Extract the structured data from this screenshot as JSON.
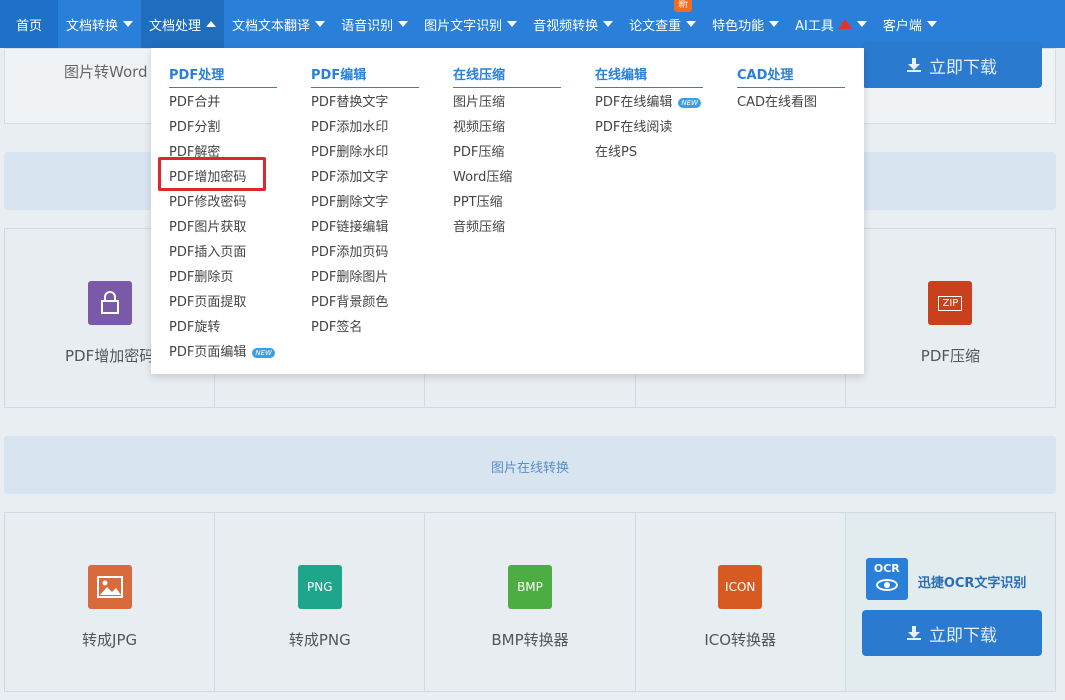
{
  "nav": {
    "items": [
      {
        "label": "首页",
        "caret": false
      },
      {
        "label": "文档转换",
        "caret": true
      },
      {
        "label": "文档处理",
        "caret": true,
        "active": true
      },
      {
        "label": "文档文本翻译",
        "caret": true
      },
      {
        "label": "语音识别",
        "caret": true
      },
      {
        "label": "图片文字识别",
        "caret": true
      },
      {
        "label": "音视频转换",
        "caret": true
      },
      {
        "label": "论文查重",
        "caret": true,
        "badge": "新"
      },
      {
        "label": "特色功能",
        "caret": true
      },
      {
        "label": "AI工具",
        "caret": true
      },
      {
        "label": "客户端",
        "caret": true
      }
    ]
  },
  "background": {
    "top_card_label": "图片转Word",
    "download_label": "立即下载",
    "band_label": "图片在线转换",
    "row1": {
      "first_label": "PDF增加密码",
      "last_label": "PDF压缩",
      "last_icon_text": "ZIP"
    },
    "row2": [
      {
        "label": "转成JPG",
        "icon_text": "",
        "icon": "image-icon",
        "color": "#d86a3c"
      },
      {
        "label": "转成PNG",
        "icon_text": "PNG",
        "icon": "png-icon",
        "color": "#1fa58a"
      },
      {
        "label": "BMP转换器",
        "icon_text": "BMP",
        "icon": "bmp-icon",
        "color": "#4cae42"
      },
      {
        "label": "ICO转换器",
        "icon_text": "ICON",
        "icon": "ico-icon",
        "color": "#d85a23"
      }
    ],
    "ocr": {
      "badge": "OCR",
      "label": "迅捷OCR文字识别",
      "download_label": "立即下载"
    }
  },
  "dropdown": {
    "columns": [
      {
        "title": "PDF处理",
        "items": [
          {
            "label": "PDF合并"
          },
          {
            "label": "PDF分割"
          },
          {
            "label": "PDF解密"
          },
          {
            "label": "PDF增加密码",
            "highlighted": true
          },
          {
            "label": "PDF修改密码"
          },
          {
            "label": "PDF图片获取"
          },
          {
            "label": "PDF插入页面"
          },
          {
            "label": "PDF删除页"
          },
          {
            "label": "PDF页面提取"
          },
          {
            "label": "PDF旋转"
          },
          {
            "label": "PDF页面编辑",
            "new": "NEW"
          }
        ]
      },
      {
        "title": "PDF编辑",
        "items": [
          {
            "label": "PDF替换文字"
          },
          {
            "label": "PDF添加水印"
          },
          {
            "label": "PDF删除水印"
          },
          {
            "label": "PDF添加文字"
          },
          {
            "label": "PDF删除文字"
          },
          {
            "label": "PDF链接编辑"
          },
          {
            "label": "PDF添加页码"
          },
          {
            "label": "PDF删除图片"
          },
          {
            "label": "PDF背景颜色"
          },
          {
            "label": "PDF签名"
          }
        ]
      },
      {
        "title": "在线压缩",
        "items": [
          {
            "label": "图片压缩"
          },
          {
            "label": "视频压缩"
          },
          {
            "label": "PDF压缩"
          },
          {
            "label": "Word压缩"
          },
          {
            "label": "PPT压缩"
          },
          {
            "label": "音频压缩"
          }
        ]
      },
      {
        "title": "在线编辑",
        "items": [
          {
            "label": "PDF在线编辑",
            "new": "NEW"
          },
          {
            "label": "PDF在线阅读"
          },
          {
            "label": "在线PS"
          }
        ]
      },
      {
        "title": "CAD处理",
        "items": [
          {
            "label": "CAD在线看图"
          }
        ]
      }
    ]
  }
}
